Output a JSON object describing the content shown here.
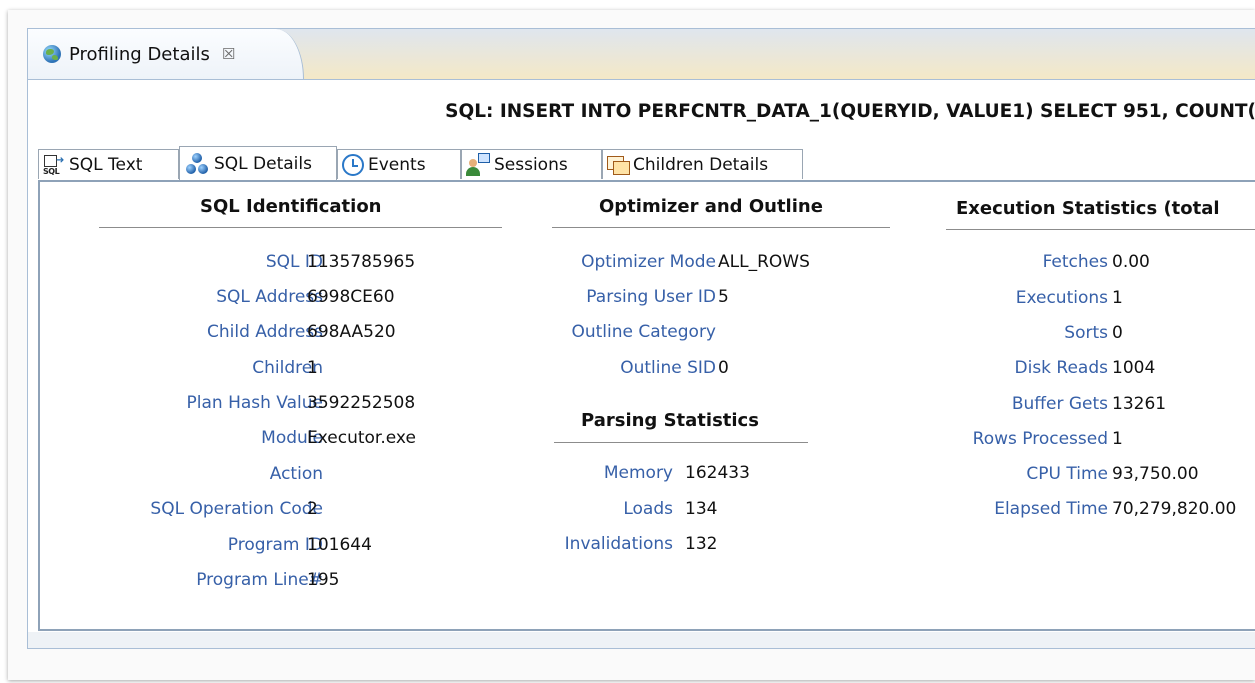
{
  "view_tab": {
    "title": "Profiling Details",
    "close_glyph": "☒",
    "icon": "globe-icon"
  },
  "sql_title": "SQL: INSERT INTO PERFCNTR_DATA_1(QUERYID, VALUE1) SELECT 951, COUNT(",
  "tabs": [
    {
      "label": "SQL Text",
      "icon": "sql-text-icon"
    },
    {
      "label": "SQL Details",
      "icon": "sql-details-icon",
      "selected": true
    },
    {
      "label": "Events",
      "icon": "clock-icon"
    },
    {
      "label": "Sessions",
      "icon": "sessions-icon"
    },
    {
      "label": "Children Details",
      "icon": "children-details-icon"
    }
  ],
  "sql_identification": {
    "title": "SQL Identification",
    "rows": [
      {
        "label": "SQL ID",
        "value": "1135785965"
      },
      {
        "label": "SQL Address",
        "value": "6998CE60"
      },
      {
        "label": "Child Address",
        "value": "698AA520"
      },
      {
        "label": "Children",
        "value": "1"
      },
      {
        "label": "Plan Hash Value",
        "value": "3592252508"
      },
      {
        "label": "Module",
        "value": "Executor.exe"
      },
      {
        "label": "Action",
        "value": ""
      },
      {
        "label": "SQL Operation Code",
        "value": "2"
      },
      {
        "label": "Program ID",
        "value": "101644"
      },
      {
        "label": "Program Line#",
        "value": "195"
      }
    ]
  },
  "optimizer": {
    "title": "Optimizer and Outline",
    "rows": [
      {
        "label": "Optimizer Mode",
        "value": "ALL_ROWS"
      },
      {
        "label": "Parsing User ID",
        "value": "5"
      },
      {
        "label": "Outline Category",
        "value": ""
      },
      {
        "label": "Outline SID",
        "value": "0"
      }
    ]
  },
  "parsing": {
    "title": "Parsing Statistics",
    "rows": [
      {
        "label": "Memory",
        "value": "162433"
      },
      {
        "label": "Loads",
        "value": "134"
      },
      {
        "label": "Invalidations",
        "value": "132"
      }
    ]
  },
  "execution": {
    "title": "Execution Statistics (total",
    "rows": [
      {
        "label": "Fetches",
        "value": "0.00"
      },
      {
        "label": "Executions",
        "value": "1"
      },
      {
        "label": "Sorts",
        "value": "0"
      },
      {
        "label": "Disk Reads",
        "value": "1004"
      },
      {
        "label": "Buffer Gets",
        "value": "13261"
      },
      {
        "label": "Rows Processed",
        "value": "1"
      },
      {
        "label": "CPU Time",
        "value": "93,750.00"
      },
      {
        "label": "Elapsed Time",
        "value": "70,279,820.00"
      }
    ]
  },
  "colors": {
    "label": "#3760a8",
    "value": "#111111",
    "border": "#a9bed6"
  }
}
